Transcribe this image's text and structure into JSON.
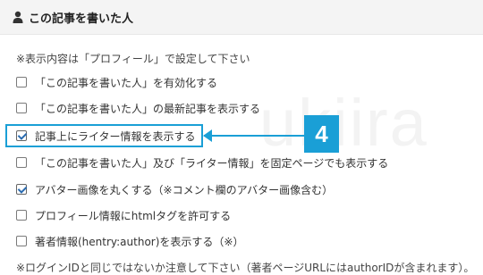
{
  "header": {
    "title": "この記事を書いた人"
  },
  "note_top": "※表示内容は「プロフィール」で設定して下さい",
  "options": [
    {
      "label": "「この記事を書いた人」を有効化する",
      "checked": false
    },
    {
      "label": "「この記事を書いた人」の最新記事を表示する",
      "checked": false
    },
    {
      "label": "記事上にライター情報を表示する",
      "checked": true
    },
    {
      "label": "「この記事を書いた人」及び「ライター情報」を固定ページでも表示する",
      "checked": false
    },
    {
      "label": "アバター画像を丸くする（※コメント欄のアバター画像含む）",
      "checked": true
    },
    {
      "label": "プロフィール情報にhtmlタグを許可する",
      "checked": false
    },
    {
      "label": "著者情報(hentry:author)を表示する（※）",
      "checked": false
    }
  ],
  "badge": "4",
  "note_bottom": "※ログインIDと同じではないか注意して下さい（著者ページURLにはauthorIDが含まれます）。",
  "watermark": "ukiira",
  "colors": {
    "accent": "#1a9fd6",
    "header_bg": "#f4f4f4"
  }
}
